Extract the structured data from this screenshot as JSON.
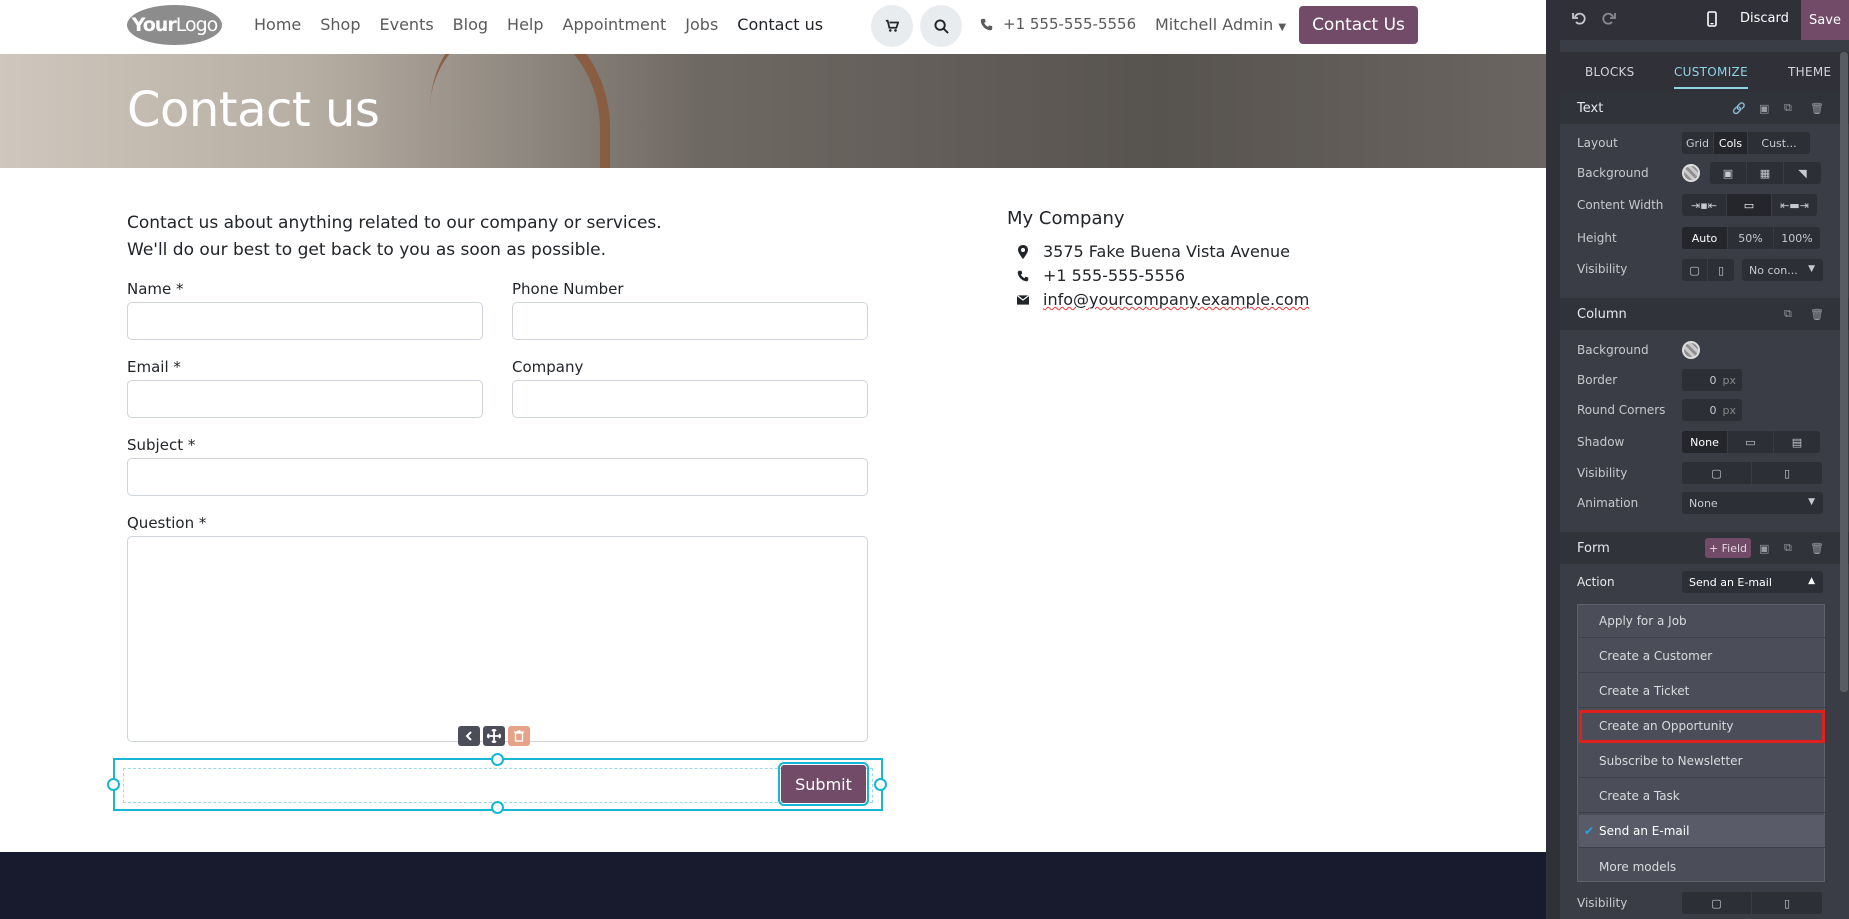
{
  "site": {
    "logo": {
      "bold": "Your",
      "rest": "Logo"
    },
    "nav": [
      "Home",
      "Shop",
      "Events",
      "Blog",
      "Help",
      "Appointment",
      "Jobs",
      "Contact us"
    ],
    "phone": "+1 555-555-5556",
    "user": "Mitchell Admin",
    "cta": "Contact Us",
    "hero_title": "Contact us",
    "intro_line1": "Contact us about anything related to our company or services.",
    "intro_line2": "We'll do our best to get back to you as soon as possible.",
    "form": {
      "name_label": "Name *",
      "phone_label": "Phone Number",
      "email_label": "Email *",
      "company_label": "Company",
      "subject_label": "Subject *",
      "question_label": "Question *",
      "submit": "Submit"
    },
    "company": {
      "title": "My Company",
      "address": "3575 Fake Buena Vista Avenue",
      "phone": "+1 555-555-5556",
      "email": "info@yourcompany.example.com"
    }
  },
  "panel": {
    "discard": "Discard",
    "save": "Save",
    "tabs": [
      "BLOCKS",
      "CUSTOMIZE",
      "THEME"
    ],
    "active_tab": "CUSTOMIZE",
    "text_section": {
      "title": "Text",
      "layout_label": "Layout",
      "layout_options": [
        "Grid",
        "Cols",
        "Cust..."
      ],
      "background_label": "Background",
      "content_width_label": "Content Width",
      "height_label": "Height",
      "height_options": [
        "Auto",
        "50%",
        "100%"
      ],
      "visibility_label": "Visibility",
      "visibility_value": "No con..."
    },
    "column_section": {
      "title": "Column",
      "background_label": "Background",
      "border_label": "Border",
      "border_value": "0",
      "round_corners_label": "Round Corners",
      "round_value": "0",
      "unit": "px",
      "shadow_label": "Shadow",
      "shadow_value": "None",
      "visibility_label": "Visibility",
      "animation_label": "Animation",
      "animation_value": "None"
    },
    "form_section": {
      "title": "Form",
      "add_field": "+ Field",
      "action_label": "Action",
      "action_value": "Send an E-mail",
      "action_options": [
        "Apply for a Job",
        "Create a Customer",
        "Create a Ticket",
        "Create an Opportunity",
        "Subscribe to Newsletter",
        "Create a Task",
        "Send an E-mail",
        "More models"
      ],
      "selected_option": "Send an E-mail",
      "highlighted_option": "Create an Opportunity",
      "visibility_label": "Visibility"
    }
  }
}
